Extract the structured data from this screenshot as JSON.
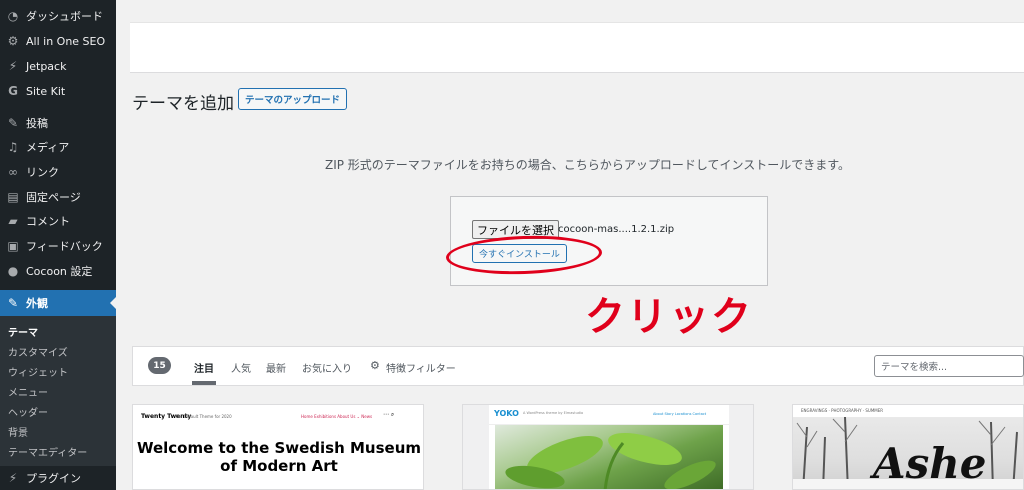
{
  "sidebar": {
    "items": [
      {
        "label": "ダッシュボード",
        "icon": "dashboard-icon"
      },
      {
        "label": "All in One SEO",
        "icon": "gear-icon"
      },
      {
        "label": "Jetpack",
        "icon": "jetpack-icon"
      },
      {
        "label": "Site Kit",
        "icon": "sitekit-icon"
      },
      {
        "label": "投稿",
        "icon": "pushpin-icon"
      },
      {
        "label": "メディア",
        "icon": "media-icon"
      },
      {
        "label": "リンク",
        "icon": "link-icon"
      },
      {
        "label": "固定ページ",
        "icon": "page-icon"
      },
      {
        "label": "コメント",
        "icon": "comment-icon"
      },
      {
        "label": "フィードバック",
        "icon": "feedback-icon"
      },
      {
        "label": "Cocoon 設定",
        "icon": "cocoon-icon"
      },
      {
        "label": "外観",
        "icon": "brush-icon"
      },
      {
        "label": "プラグイン",
        "icon": "plugin-icon"
      }
    ],
    "submenu": [
      "テーマ",
      "カスタマイズ",
      "ウィジェット",
      "メニュー",
      "ヘッダー",
      "背景",
      "テーマエディター"
    ],
    "active_color": "#2271b1"
  },
  "header": {
    "title": "テーマを追加",
    "upload_button": "テーマのアップロード"
  },
  "upload": {
    "description": "ZIP 形式のテーマファイルをお持ちの場合、こちらからアップロードしてインストールできます。",
    "file_button": "ファイルを選択",
    "file_name": "cocoon-mas....1.2.1.zip",
    "install_button": "今すぐインストール"
  },
  "annotation": {
    "text": "クリック",
    "color": "#e0001b"
  },
  "filter": {
    "count": "15",
    "tabs": [
      "注目",
      "人気",
      "最新",
      "お気に入り"
    ],
    "feature_filter": "特徴フィルター",
    "search_placeholder": "テーマを検索..."
  },
  "themes": {
    "twenty": {
      "logo": "Twenty Twenty",
      "tagline": "The Default Theme for 2020",
      "nav": "Home   Exhibitions   About Us ⌄   News",
      "headline": "Welcome to the Swedish Museum of Modern Art"
    },
    "yoko": {
      "logo": "YOKO",
      "tagline": "A WordPress theme by Elmastudio",
      "nav": "About   Story   Locations   Contact"
    },
    "ashe": {
      "top": "ENGRAVINGS · PHOTOGRAPHY · SUMMER",
      "word": "Ashe"
    }
  }
}
